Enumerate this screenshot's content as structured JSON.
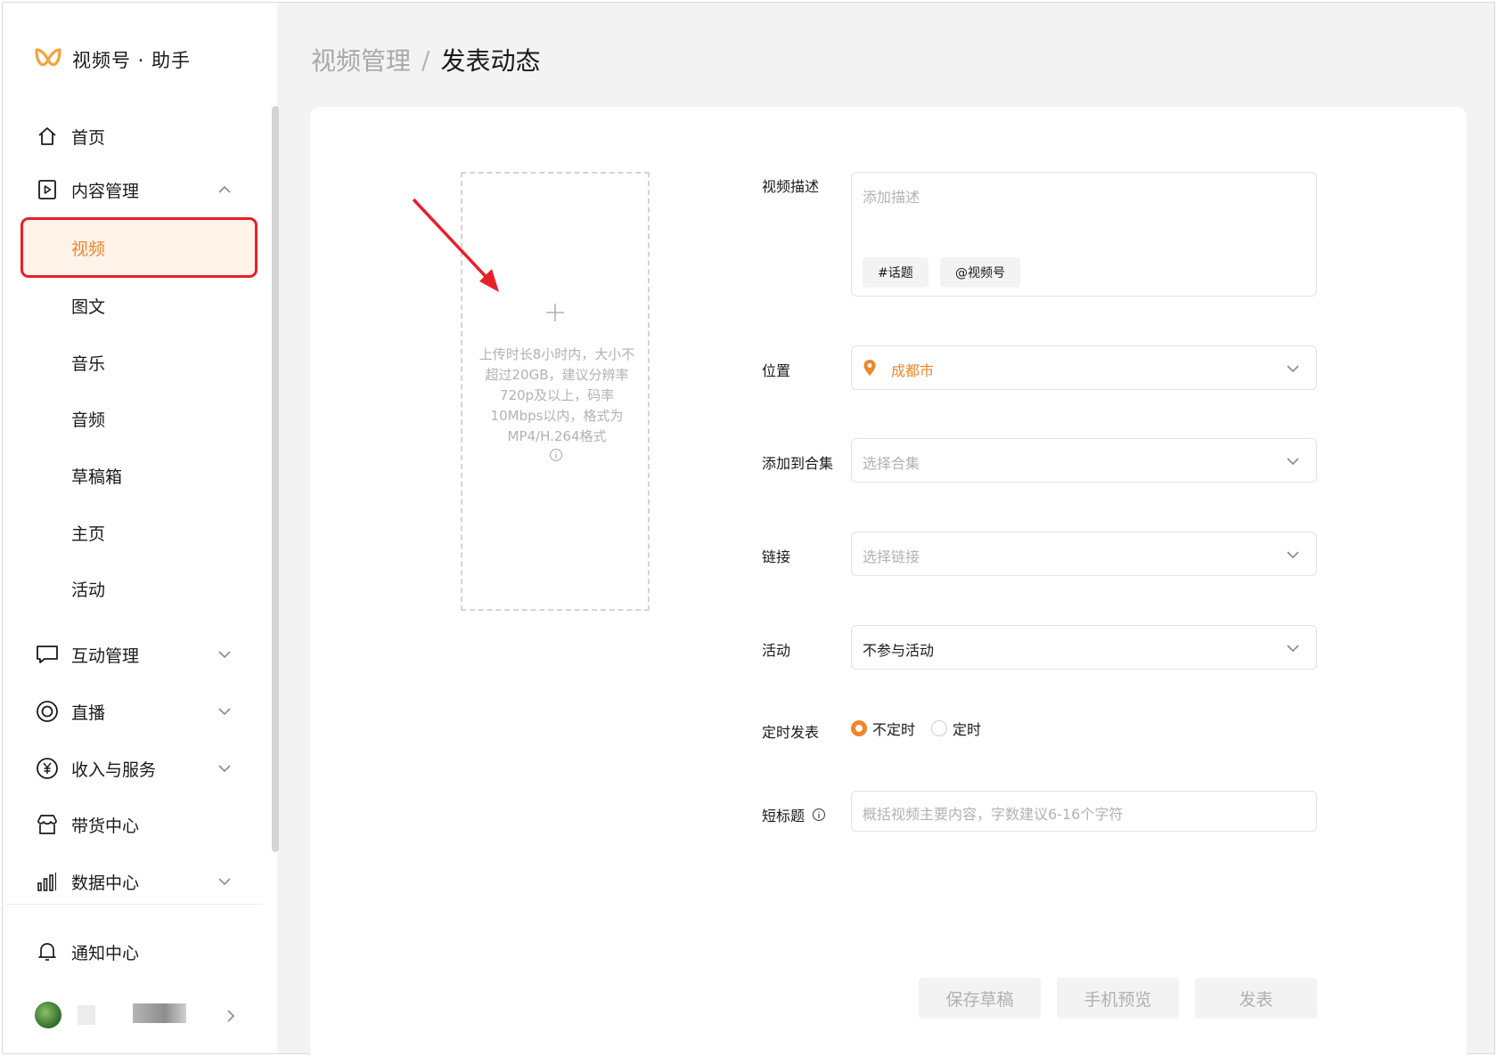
{
  "brand": {
    "title": "视频号 · 助手"
  },
  "sidebar": {
    "items": [
      {
        "label": "首页",
        "icon": "home-icon"
      },
      {
        "label": "内容管理",
        "icon": "content-play-icon",
        "expanded": true,
        "children": [
          "视频",
          "图文",
          "音乐",
          "音频",
          "草稿箱",
          "主页",
          "活动"
        ],
        "active_child": "视频"
      },
      {
        "label": "互动管理",
        "icon": "comment-icon"
      },
      {
        "label": "直播",
        "icon": "live-circle-icon"
      },
      {
        "label": "收入与服务",
        "icon": "yuan-icon"
      },
      {
        "label": "带货中心",
        "icon": "shop-icon"
      },
      {
        "label": "数据中心",
        "icon": "bar-chart-icon"
      }
    ],
    "notify": {
      "label": "通知中心",
      "icon": "bell-icon"
    }
  },
  "breadcrumb": {
    "parent": "视频管理",
    "separator": "/",
    "current": "发表动态"
  },
  "upload": {
    "hint": "上传时长8小时内，大小不超过20GB，建议分辨率720p及以上，码率10Mbps以内，格式为MP4/H.264格式"
  },
  "form": {
    "description": {
      "label": "视频描述",
      "placeholder": "添加描述",
      "tags": [
        "#话题",
        "@视频号"
      ]
    },
    "location": {
      "label": "位置",
      "value": "成都市"
    },
    "collection": {
      "label": "添加到合集",
      "placeholder": "选择合集"
    },
    "link": {
      "label": "链接",
      "placeholder": "选择链接"
    },
    "activity": {
      "label": "活动",
      "value": "不参与活动"
    },
    "schedule": {
      "label": "定时发表",
      "options": [
        "不定时",
        "定时"
      ],
      "selected": "不定时"
    },
    "short_title": {
      "label": "短标题",
      "placeholder": "概括视频主要内容，字数建议6-16个字符"
    }
  },
  "actions": {
    "save_draft": "保存草稿",
    "preview": "手机预览",
    "publish": "发表"
  },
  "colors": {
    "accent": "#f0852b",
    "highlight_border": "#e8202a",
    "active_bg": "#fff3ea"
  }
}
